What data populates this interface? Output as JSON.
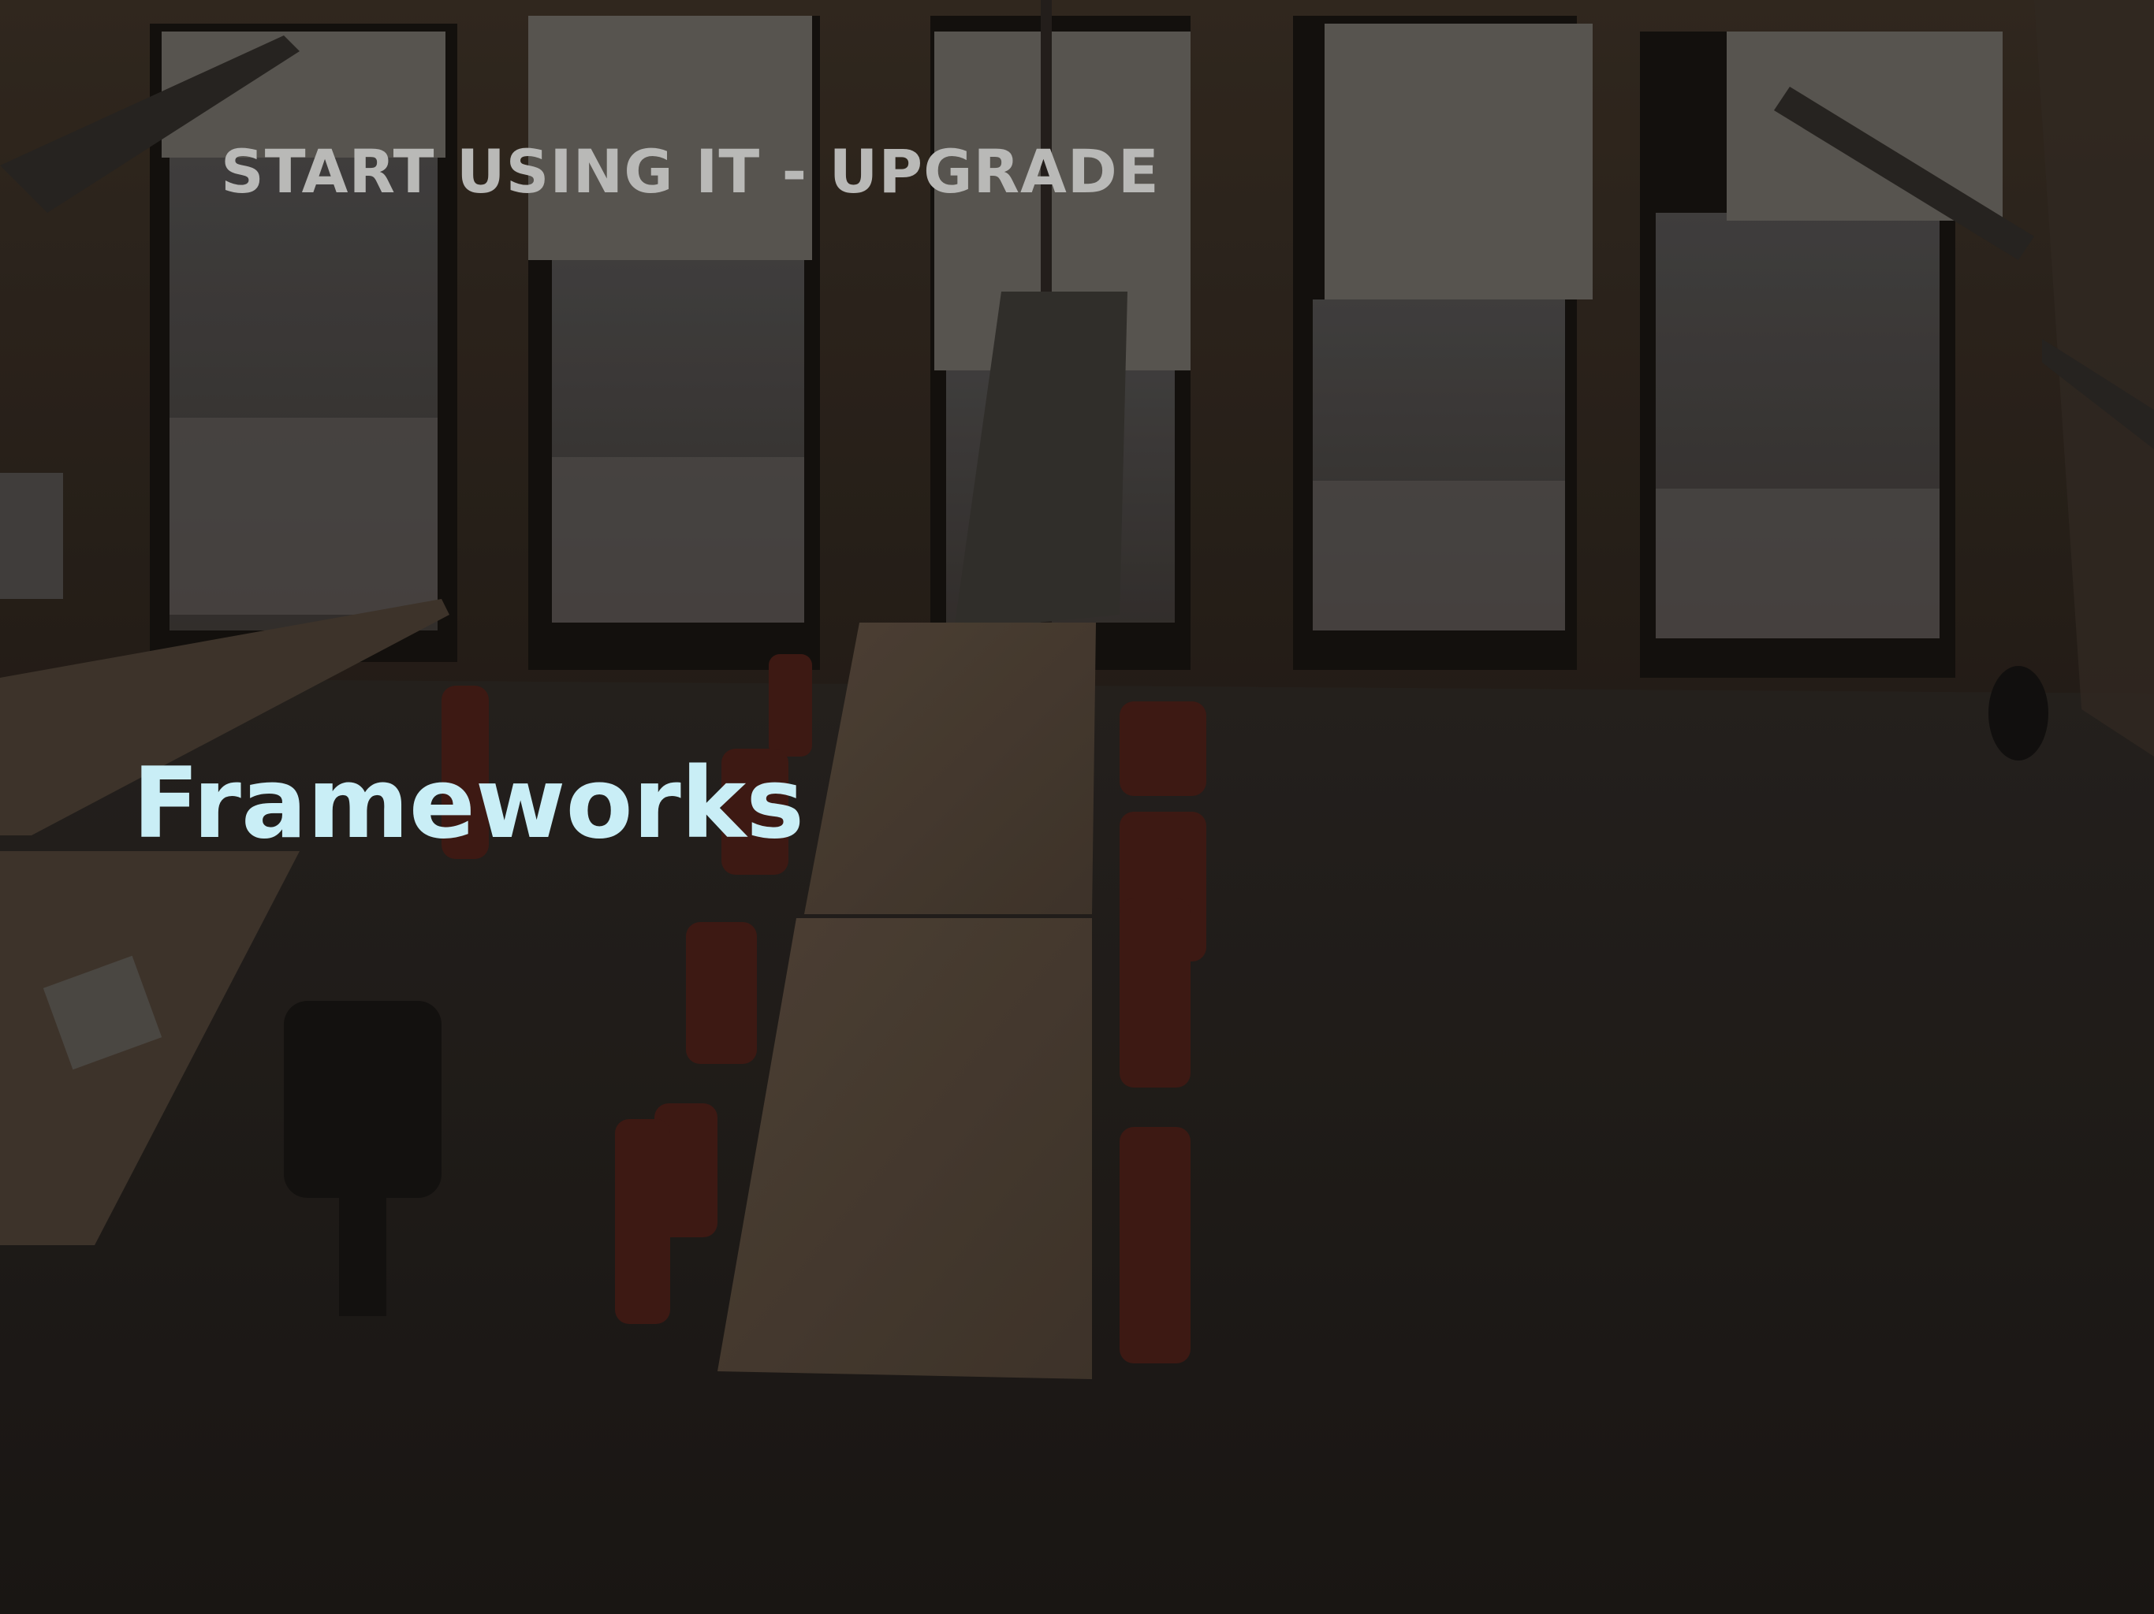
{
  "slide": {
    "kicker": "START USING IT - UPGRADE",
    "title": "Frameworks"
  },
  "colors": {
    "kicker_text": "#b9b9b7",
    "title_text": "#c9eef6",
    "background_tint": "#1c1815"
  },
  "background": {
    "image": "dimmed-office-interior-photo"
  }
}
